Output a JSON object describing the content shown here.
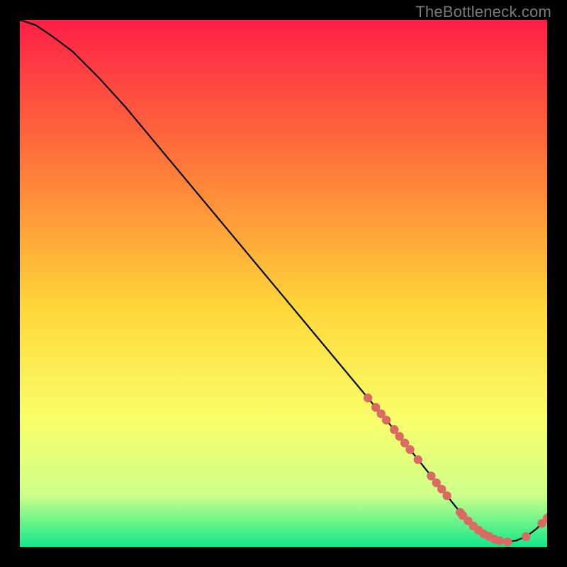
{
  "watermark": "TheBottleneck.com",
  "colors": {
    "gradient_top": "#ff1f47",
    "gradient_mid_upper": "#ff7a3a",
    "gradient_mid": "#ffd83a",
    "gradient_mid_lower": "#f8ff6a",
    "gradient_lower": "#cfff8a",
    "gradient_bottom": "#10e88a",
    "curve": "#000000",
    "marker": "#d96b62"
  },
  "chart_data": {
    "type": "line",
    "title": "",
    "xlabel": "",
    "ylabel": "",
    "xlim": [
      0,
      100
    ],
    "ylim": [
      0,
      100
    ],
    "grid": false,
    "legend": false,
    "series": [
      {
        "name": "bottleneck-curve",
        "x": [
          0,
          3,
          6,
          10,
          15,
          20,
          25,
          30,
          35,
          40,
          45,
          50,
          55,
          60,
          65,
          70,
          72,
          74,
          76,
          78,
          80,
          82,
          84,
          86,
          88,
          90,
          92,
          94,
          96,
          98,
          100
        ],
        "y": [
          100,
          99,
          97,
          94,
          89,
          83.5,
          77.5,
          71.5,
          65.5,
          59.5,
          53.5,
          47.5,
          41.5,
          35.5,
          29.5,
          23.5,
          21,
          18.5,
          16,
          13.5,
          11,
          8.5,
          6,
          4,
          2.5,
          1.5,
          1,
          1.2,
          2,
          3.5,
          5.5
        ]
      }
    ],
    "markers": [
      {
        "x": 66,
        "y": 28.3
      },
      {
        "x": 67.5,
        "y": 26.5
      },
      {
        "x": 68.5,
        "y": 25.3
      },
      {
        "x": 69.5,
        "y": 24.1
      },
      {
        "x": 71,
        "y": 22.3
      },
      {
        "x": 72,
        "y": 21
      },
      {
        "x": 73,
        "y": 19.75
      },
      {
        "x": 74,
        "y": 18.5
      },
      {
        "x": 75.5,
        "y": 16.6
      },
      {
        "x": 78,
        "y": 13.5
      },
      {
        "x": 79,
        "y": 12.2
      },
      {
        "x": 80,
        "y": 11
      },
      {
        "x": 81,
        "y": 9.75
      },
      {
        "x": 83.5,
        "y": 6.6
      },
      {
        "x": 84,
        "y": 6
      },
      {
        "x": 85,
        "y": 5
      },
      {
        "x": 86,
        "y": 4
      },
      {
        "x": 87,
        "y": 3.2
      },
      {
        "x": 88,
        "y": 2.5
      },
      {
        "x": 89,
        "y": 2
      },
      {
        "x": 90,
        "y": 1.5
      },
      {
        "x": 91,
        "y": 1.2
      },
      {
        "x": 92.5,
        "y": 1
      },
      {
        "x": 96,
        "y": 2
      },
      {
        "x": 99,
        "y": 4.5
      },
      {
        "x": 100,
        "y": 5.5
      }
    ]
  }
}
